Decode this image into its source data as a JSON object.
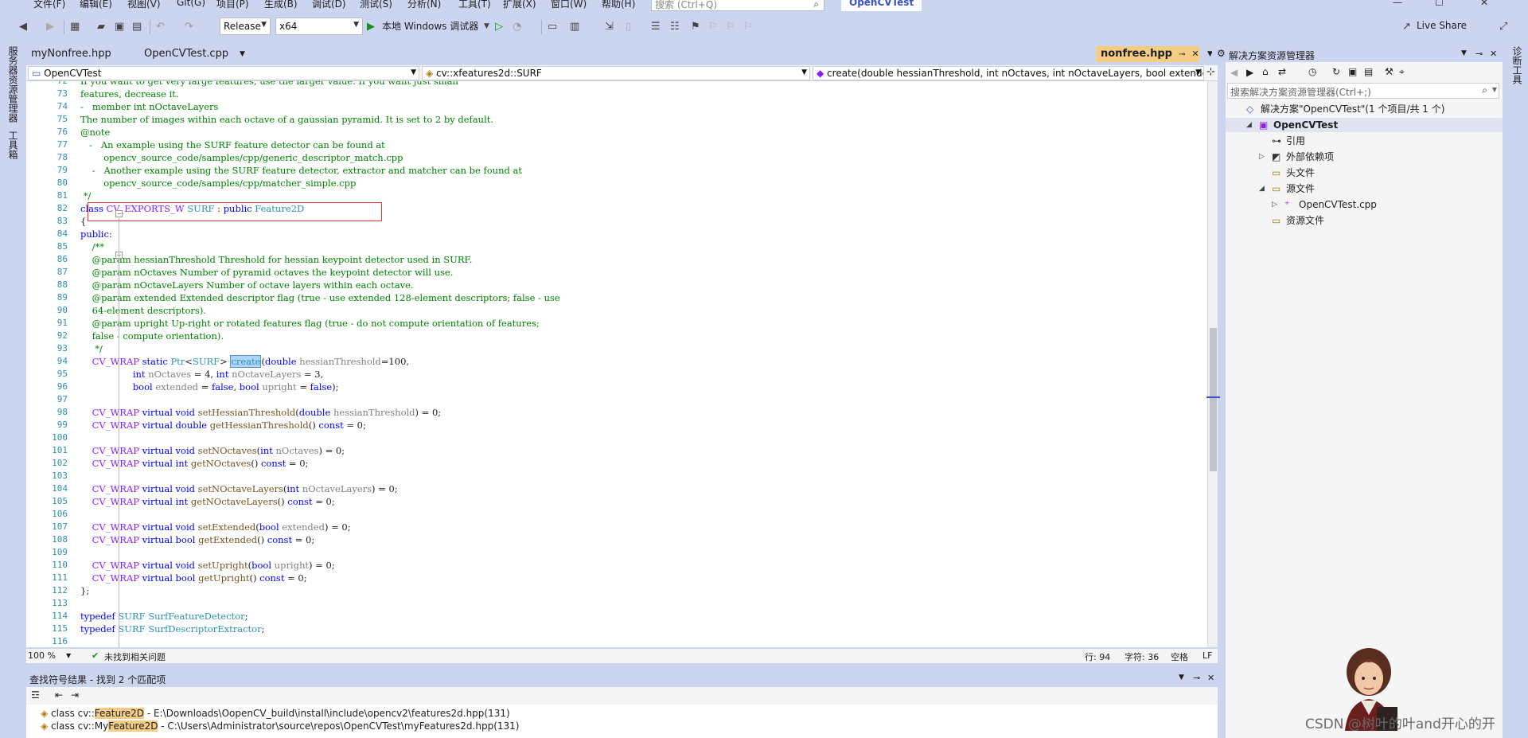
{
  "menu": {
    "items": [
      "文件(F)",
      "编辑(E)",
      "视图(V)",
      "Git(G)",
      "项目(P)",
      "生成(B)",
      "调试(D)",
      "测试(S)",
      "分析(N)",
      "工具(T)",
      "扩展(X)",
      "窗口(W)",
      "帮助(H)"
    ],
    "search_placeholder": "搜索 (Ctrl+Q)",
    "project_title": "OpenCVTest"
  },
  "toolbar": {
    "config": "Release",
    "platform": "x64",
    "debugger": "本地 Windows 调试器",
    "live_share": "Live Share"
  },
  "left_tabs": [
    "服务器资源管理器",
    "工具箱"
  ],
  "right_tabs": [
    "诊断工具"
  ],
  "doc_tabs": {
    "left": [
      "myNonfree.hpp",
      "OpenCVTest.cpp"
    ],
    "active": "nonfree.hpp"
  },
  "navbar": {
    "project": "OpenCVTest",
    "scope": "cv::xfeatures2d::SURF",
    "member": "create(double hessianThreshold, int nOctaves, int nOctaveLayers, bool extende"
  },
  "code": {
    "lines": [
      {
        "n": "72",
        "segs": [
          [
            "c-cmt",
            "If you want to get very large features, use the larger value. If you want just small"
          ]
        ]
      },
      {
        "n": "73",
        "segs": [
          [
            "c-cmt",
            "features, decrease it."
          ]
        ]
      },
      {
        "n": "74",
        "segs": [
          [
            "c-cmt",
            "-   member int nOctaveLayers"
          ]
        ]
      },
      {
        "n": "75",
        "segs": [
          [
            "c-cmt",
            "The number of images within each octave of a gaussian pyramid. It is set to 2 by default."
          ]
        ]
      },
      {
        "n": "76",
        "segs": [
          [
            "c-cmt",
            "@note"
          ]
        ]
      },
      {
        "n": "77",
        "segs": [
          [
            "c-cmt",
            "   -   An example using the SURF feature detector can be found at"
          ]
        ]
      },
      {
        "n": "78",
        "segs": [
          [
            "c-cmt",
            "        opencv_source_code/samples/cpp/generic_descriptor_match.cpp"
          ]
        ]
      },
      {
        "n": "79",
        "segs": [
          [
            "c-cmt",
            "    -   Another example using the SURF feature detector, extractor and matcher can be found at"
          ]
        ]
      },
      {
        "n": "80",
        "segs": [
          [
            "c-cmt",
            "        opencv_source_code/samples/cpp/matcher_simple.cpp"
          ]
        ]
      },
      {
        "n": "81",
        "segs": [
          [
            "c-cmt",
            " */"
          ]
        ]
      },
      {
        "n": "82",
        "segs": [
          [
            "c-kw",
            "class "
          ],
          [
            "c-mac",
            "CV_EXPORTS_W "
          ],
          [
            "c-typ",
            "SURF"
          ],
          [
            "c-txt",
            " : "
          ],
          [
            "c-kw",
            "public "
          ],
          [
            "c-typ",
            "Feature2D"
          ]
        ]
      },
      {
        "n": "83",
        "segs": [
          [
            "c-txt",
            "{"
          ]
        ]
      },
      {
        "n": "84",
        "segs": [
          [
            "c-kw",
            "public"
          ],
          [
            "c-txt",
            ":"
          ]
        ]
      },
      {
        "n": "85",
        "segs": [
          [
            "c-cmt",
            "    /**"
          ]
        ]
      },
      {
        "n": "86",
        "segs": [
          [
            "c-cmt",
            "    @param hessianThreshold Threshold for hessian keypoint detector used in SURF."
          ]
        ]
      },
      {
        "n": "87",
        "segs": [
          [
            "c-cmt",
            "    @param nOctaves Number of pyramid octaves the keypoint detector will use."
          ]
        ]
      },
      {
        "n": "88",
        "segs": [
          [
            "c-cmt",
            "    @param nOctaveLayers Number of octave layers within each octave."
          ]
        ]
      },
      {
        "n": "89",
        "segs": [
          [
            "c-cmt",
            "    @param extended Extended descriptor flag (true - use extended 128-element descriptors; false - use"
          ]
        ]
      },
      {
        "n": "90",
        "segs": [
          [
            "c-cmt",
            "    64-element descriptors)."
          ]
        ]
      },
      {
        "n": "91",
        "segs": [
          [
            "c-cmt",
            "    @param upright Up-right or rotated features flag (true - do not compute orientation of features;"
          ]
        ]
      },
      {
        "n": "92",
        "segs": [
          [
            "c-cmt",
            "    false - compute orientation)."
          ]
        ]
      },
      {
        "n": "93",
        "segs": [
          [
            "c-cmt",
            "     */"
          ]
        ]
      },
      {
        "n": "94",
        "segs": [
          [
            "c-txt",
            "    "
          ],
          [
            "c-mac",
            "CV_WRAP "
          ],
          [
            "c-kw",
            "static "
          ],
          [
            "c-typ",
            "Ptr"
          ],
          [
            "c-txt",
            "<"
          ],
          [
            "c-typ",
            "SURF"
          ],
          [
            "c-txt",
            "> "
          ],
          [
            "hl",
            "create"
          ],
          [
            "c-txt",
            "("
          ],
          [
            "c-kw",
            "double "
          ],
          [
            "c-par",
            "hessianThreshold"
          ],
          [
            "c-txt",
            "=100,"
          ]
        ]
      },
      {
        "n": "95",
        "segs": [
          [
            "c-txt",
            "                  "
          ],
          [
            "c-kw",
            "int "
          ],
          [
            "c-par",
            "nOctaves"
          ],
          [
            "c-txt",
            " = 4, "
          ],
          [
            "c-kw",
            "int "
          ],
          [
            "c-par",
            "nOctaveLayers"
          ],
          [
            "c-txt",
            " = 3,"
          ]
        ]
      },
      {
        "n": "96",
        "segs": [
          [
            "c-txt",
            "                  "
          ],
          [
            "c-kw",
            "bool "
          ],
          [
            "c-par",
            "extended"
          ],
          [
            "c-txt",
            " = "
          ],
          [
            "c-kw",
            "false"
          ],
          [
            "c-txt",
            ", "
          ],
          [
            "c-kw",
            "bool "
          ],
          [
            "c-par",
            "upright"
          ],
          [
            "c-txt",
            " = "
          ],
          [
            "c-kw",
            "false"
          ],
          [
            "c-txt",
            ");"
          ]
        ]
      },
      {
        "n": "97",
        "segs": []
      },
      {
        "n": "98",
        "segs": [
          [
            "c-txt",
            "    "
          ],
          [
            "c-mac",
            "CV_WRAP "
          ],
          [
            "c-kw",
            "virtual void "
          ],
          [
            "c-fn",
            "setHessianThreshold"
          ],
          [
            "c-txt",
            "("
          ],
          [
            "c-kw",
            "double "
          ],
          [
            "c-par",
            "hessianThreshold"
          ],
          [
            "c-txt",
            ") = 0;"
          ]
        ]
      },
      {
        "n": "99",
        "segs": [
          [
            "c-txt",
            "    "
          ],
          [
            "c-mac",
            "CV_WRAP "
          ],
          [
            "c-kw",
            "virtual double "
          ],
          [
            "c-fn",
            "getHessianThreshold"
          ],
          [
            "c-txt",
            "() "
          ],
          [
            "c-kw",
            "const"
          ],
          [
            "c-txt",
            " = 0;"
          ]
        ]
      },
      {
        "n": "100",
        "segs": []
      },
      {
        "n": "101",
        "segs": [
          [
            "c-txt",
            "    "
          ],
          [
            "c-mac",
            "CV_WRAP "
          ],
          [
            "c-kw",
            "virtual void "
          ],
          [
            "c-fn",
            "setNOctaves"
          ],
          [
            "c-txt",
            "("
          ],
          [
            "c-kw",
            "int "
          ],
          [
            "c-par",
            "nOctaves"
          ],
          [
            "c-txt",
            ") = 0;"
          ]
        ]
      },
      {
        "n": "102",
        "segs": [
          [
            "c-txt",
            "    "
          ],
          [
            "c-mac",
            "CV_WRAP "
          ],
          [
            "c-kw",
            "virtual int "
          ],
          [
            "c-fn",
            "getNOctaves"
          ],
          [
            "c-txt",
            "() "
          ],
          [
            "c-kw",
            "const"
          ],
          [
            "c-txt",
            " = 0;"
          ]
        ]
      },
      {
        "n": "103",
        "segs": []
      },
      {
        "n": "104",
        "segs": [
          [
            "c-txt",
            "    "
          ],
          [
            "c-mac",
            "CV_WRAP "
          ],
          [
            "c-kw",
            "virtual void "
          ],
          [
            "c-fn",
            "setNOctaveLayers"
          ],
          [
            "c-txt",
            "("
          ],
          [
            "c-kw",
            "int "
          ],
          [
            "c-par",
            "nOctaveLayers"
          ],
          [
            "c-txt",
            ") = 0;"
          ]
        ]
      },
      {
        "n": "105",
        "segs": [
          [
            "c-txt",
            "    "
          ],
          [
            "c-mac",
            "CV_WRAP "
          ],
          [
            "c-kw",
            "virtual int "
          ],
          [
            "c-fn",
            "getNOctaveLayers"
          ],
          [
            "c-txt",
            "() "
          ],
          [
            "c-kw",
            "const"
          ],
          [
            "c-txt",
            " = 0;"
          ]
        ]
      },
      {
        "n": "106",
        "segs": []
      },
      {
        "n": "107",
        "segs": [
          [
            "c-txt",
            "    "
          ],
          [
            "c-mac",
            "CV_WRAP "
          ],
          [
            "c-kw",
            "virtual void "
          ],
          [
            "c-fn",
            "setExtended"
          ],
          [
            "c-txt",
            "("
          ],
          [
            "c-kw",
            "bool "
          ],
          [
            "c-par",
            "extended"
          ],
          [
            "c-txt",
            ") = 0;"
          ]
        ]
      },
      {
        "n": "108",
        "segs": [
          [
            "c-txt",
            "    "
          ],
          [
            "c-mac",
            "CV_WRAP "
          ],
          [
            "c-kw",
            "virtual bool "
          ],
          [
            "c-fn",
            "getExtended"
          ],
          [
            "c-txt",
            "() "
          ],
          [
            "c-kw",
            "const"
          ],
          [
            "c-txt",
            " = 0;"
          ]
        ]
      },
      {
        "n": "109",
        "segs": []
      },
      {
        "n": "110",
        "segs": [
          [
            "c-txt",
            "    "
          ],
          [
            "c-mac",
            "CV_WRAP "
          ],
          [
            "c-kw",
            "virtual void "
          ],
          [
            "c-fn",
            "setUpright"
          ],
          [
            "c-txt",
            "("
          ],
          [
            "c-kw",
            "bool "
          ],
          [
            "c-par",
            "upright"
          ],
          [
            "c-txt",
            ") = 0;"
          ]
        ]
      },
      {
        "n": "111",
        "segs": [
          [
            "c-txt",
            "    "
          ],
          [
            "c-mac",
            "CV_WRAP "
          ],
          [
            "c-kw",
            "virtual bool "
          ],
          [
            "c-fn",
            "getUpright"
          ],
          [
            "c-txt",
            "() "
          ],
          [
            "c-kw",
            "const"
          ],
          [
            "c-txt",
            " = 0;"
          ]
        ]
      },
      {
        "n": "112",
        "segs": [
          [
            "c-txt",
            "};"
          ]
        ]
      },
      {
        "n": "113",
        "segs": []
      },
      {
        "n": "114",
        "segs": [
          [
            "c-kw",
            "typedef "
          ],
          [
            "c-typ",
            "SURF "
          ],
          [
            "c-typ",
            "SurfFeatureDetector"
          ],
          [
            "c-txt",
            ";"
          ]
        ]
      },
      {
        "n": "115",
        "segs": [
          [
            "c-kw",
            "typedef "
          ],
          [
            "c-typ",
            "SURF "
          ],
          [
            "c-typ",
            "SurfDescriptorExtractor"
          ],
          [
            "c-txt",
            ";"
          ]
        ]
      },
      {
        "n": "116",
        "segs": []
      }
    ]
  },
  "status": {
    "zoom": "100 %",
    "issues": "未找到相关问题",
    "line": "行: 94",
    "char": "字符: 36",
    "mode": "空格",
    "eol": "LF"
  },
  "find": {
    "title": "查找符号结果 - 找到 2 个匹配项",
    "results": [
      {
        "pre": "class cv::",
        "match": "Feature2D",
        "post": " - E:\\Downloads\\OopenCV_build\\install\\include\\opencv2\\features2d.hpp(131)"
      },
      {
        "pre": "class cv::My",
        "match": "Feature2D",
        "post": " - C:\\Users\\Administrator\\source\\repos\\OpenCVTest\\myFeatures2d.hpp(131)"
      }
    ]
  },
  "solution": {
    "title": "解决方案资源管理器",
    "search_placeholder": "搜索解决方案资源管理器(Ctrl+;)",
    "tree": [
      {
        "label": "解决方案\"OpenCVTest\"(1 个项目/共 1 个)",
        "level": 0,
        "tri": ""
      },
      {
        "label": "OpenCVTest",
        "level": 1,
        "tri": "◢",
        "bold": true
      },
      {
        "label": "引用",
        "level": 2,
        "tri": ""
      },
      {
        "label": "外部依赖项",
        "level": 2,
        "tri": "▷"
      },
      {
        "label": "头文件",
        "level": 2,
        "tri": ""
      },
      {
        "label": "源文件",
        "level": 2,
        "tri": "◢"
      },
      {
        "label": "OpenCVTest.cpp",
        "level": 3,
        "tri": "▷"
      },
      {
        "label": "资源文件",
        "level": 2,
        "tri": ""
      }
    ]
  },
  "watermark": "CSDN @树叶的叶and开心的开",
  "colors": {
    "accent": "#CCD5F0",
    "active_tab": "#F5CC84",
    "keyword": "#0000FF",
    "comment": "#008000",
    "macro": "#8A1BFF",
    "type": "#2B91AF"
  }
}
